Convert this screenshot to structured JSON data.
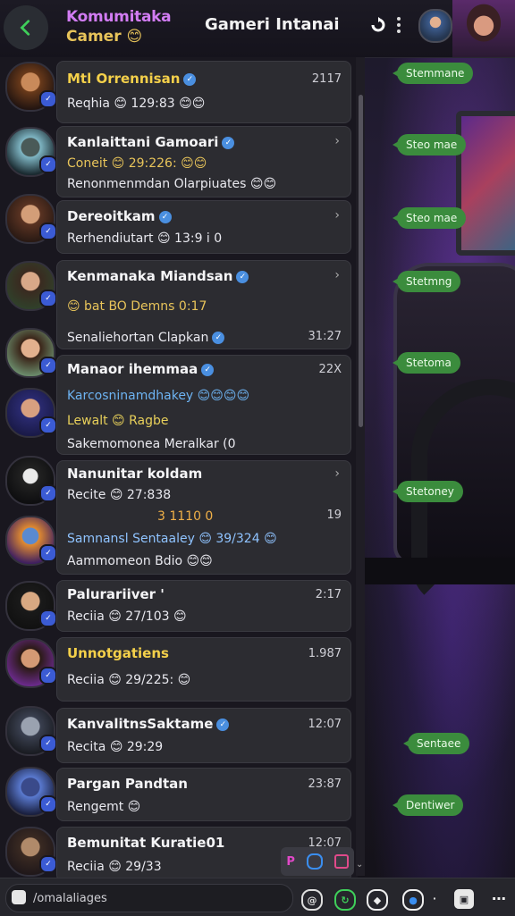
{
  "header": {
    "community_name": "Komumitaka",
    "community_sub": "Camer 😊",
    "title": "Gameri Intanai"
  },
  "colors": {
    "accent_purple": "#d27cf3",
    "accent_gold": "#e8c45a",
    "bubble_green": "#3b8c3d",
    "badge_blue": "#3b5bd4"
  },
  "chats": [
    {
      "name": "Mtl Orrennisan",
      "time": "2117",
      "line2": "Reqhia 😊 129:83 😊😊"
    },
    {
      "name": "Kanlaittani Gamoari",
      "line2": "Coneit 😊 29:226: 😊😊",
      "line3": "Renonmenmdan Olarpiuates 😊😊"
    },
    {
      "name": "Dereoitkam",
      "line2": "Rerhendiutart 😊 13:9 i 0"
    },
    {
      "name": "Kenmanaka Miandsan",
      "line2": "😊 bat  BO  Demns 0:17",
      "line3": "Senaliehortan Clapkan",
      "time3": "31:27"
    },
    {
      "name": "Manaor ihemmaa",
      "time": "22X",
      "line2": "Karcosninamdhakey 😊😊😊😊",
      "line3": "Lewalt 😊 Ragbe",
      "line4": "Sakemomonea Meralkar (0"
    },
    {
      "name": "Nanunitar koldam",
      "line2": "Recite 😊 27:838",
      "line3": "3 1110 0",
      "time3": "19",
      "line4": "Samnansl Sentaaley 😊 39/324 😊",
      "line5": "Aammomeon Bdio 😊😊"
    },
    {
      "name": "Palurariiver '",
      "time": "2:17",
      "line2": "Reciia 😊 27/103 😊"
    },
    {
      "name": "Unnotgatiens",
      "time": "1.987",
      "line2": "Reciia 😊 29/225: 😊"
    },
    {
      "name": "KanvalitnsSaktame",
      "time": "12:07",
      "line2": "Recita 😊 29:29"
    },
    {
      "name": "Pargan Pandtan",
      "time": "23:87",
      "line2": "Rengemt 😊"
    },
    {
      "name": "Bemunitat Kuratie01",
      "time": "12:07",
      "line2": "Reciia 😊 29/33"
    }
  ],
  "bubbles": [
    {
      "label": "Stemmane"
    },
    {
      "label": "Steo mae"
    },
    {
      "label": "Steo mae"
    },
    {
      "label": "Stetmng"
    },
    {
      "label": "Stetoma"
    },
    {
      "label": "Stetoney"
    },
    {
      "label": "Sentaee"
    },
    {
      "label": "Dentiwer"
    }
  ],
  "mini_toolbar": {
    "p": "P"
  },
  "composer": {
    "placeholder": "/omalaliages"
  }
}
